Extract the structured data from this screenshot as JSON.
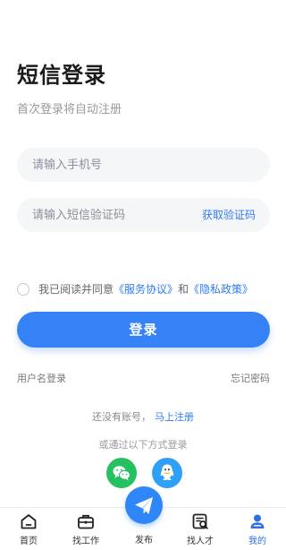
{
  "page": {
    "title": "短信登录",
    "subtitle": "首次登录将自动注册"
  },
  "form": {
    "phone_placeholder": "请输入手机号",
    "code_placeholder": "请输入短信验证码",
    "get_code_label": "获取验证码"
  },
  "agreement": {
    "prefix": "我已阅读并同意",
    "service_link": "《服务协议》",
    "and": "和",
    "privacy_link": "《隐私政策》",
    "checked": false
  },
  "login_button": "登录",
  "alt_links": {
    "username_login": "用户名登录",
    "forgot_password": "忘记密码"
  },
  "register": {
    "prompt": "还没有账号，",
    "link": "马上注册"
  },
  "other_methods": {
    "label": "或通过以下方式登录",
    "providers": [
      {
        "icon": "wechat-icon",
        "color": "#25c05f"
      },
      {
        "icon": "qq-icon",
        "color": "#2ea0f8"
      }
    ]
  },
  "tabbar": {
    "items": [
      {
        "label": "首页",
        "icon": "home-icon"
      },
      {
        "label": "找工作",
        "icon": "briefcase-icon"
      },
      {
        "label": "发布",
        "icon": "send-icon"
      },
      {
        "label": "找人才",
        "icon": "search-resume-icon"
      },
      {
        "label": "我的",
        "icon": "user-icon",
        "active": true
      }
    ],
    "active_color": "#2f6fe0"
  },
  "colors": {
    "accent": "#3581f6",
    "link": "#2f7bf5",
    "field_bg": "#f5f6f8"
  }
}
